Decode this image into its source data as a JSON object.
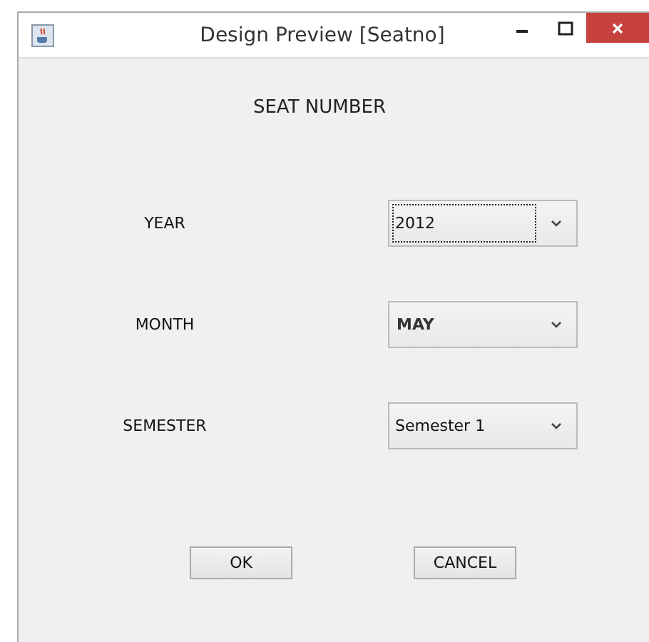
{
  "window": {
    "title": "Design Preview [Seatno]"
  },
  "heading": "SEAT NUMBER",
  "fields": [
    {
      "label": "YEAR",
      "value": "2012",
      "focused": true,
      "bold": false
    },
    {
      "label": "MONTH",
      "value": "MAY",
      "focused": false,
      "bold": true
    },
    {
      "label": "SEMESTER",
      "value": "Semester 1",
      "focused": false,
      "bold": false
    }
  ],
  "buttons": [
    "OK",
    "CANCEL"
  ]
}
